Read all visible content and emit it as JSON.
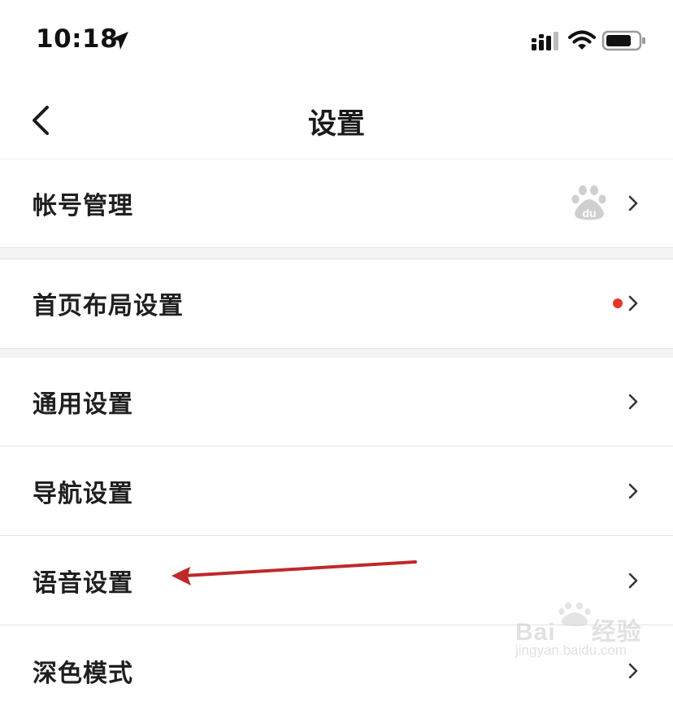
{
  "status_bar": {
    "time": "10:18",
    "icons": [
      "location-arrow-icon",
      "cellular-signal-icon",
      "wifi-icon",
      "battery-icon"
    ]
  },
  "nav": {
    "title": "设置",
    "back_icon": "chevron-left-icon"
  },
  "rows": [
    {
      "label": "帐号管理",
      "trailing": "baidu-paw-icon"
    },
    {
      "label": "首页布局设置",
      "trailing": "red-dot-badge"
    },
    {
      "label": "通用设置"
    },
    {
      "label": "导航设置"
    },
    {
      "label": "语音设置",
      "annotated": true
    },
    {
      "label": "深色模式"
    }
  ],
  "colors": {
    "text": "#1f1f1f",
    "divider": "#e4e4e4",
    "section_gap": "#f4f4f4",
    "badge_red": "#e8352a",
    "annotation_arrow": "#c0282a"
  },
  "watermark": {
    "brand_prefix": "Bai",
    "brand_suffix": "经验",
    "url": "jingyan.baidu.com"
  }
}
